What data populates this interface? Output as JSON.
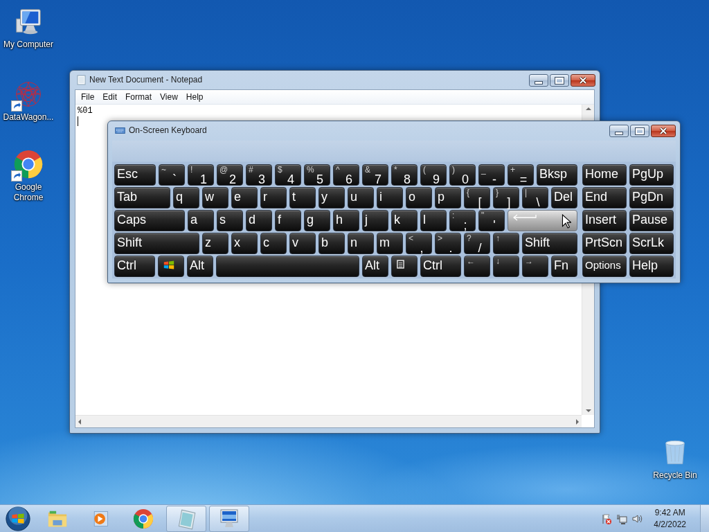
{
  "desktop_icons": [
    {
      "kind": "computer",
      "label": "My Computer",
      "shortcut": false
    },
    {
      "kind": "mesh",
      "label": "DataWagon...",
      "shortcut": true
    },
    {
      "kind": "chrome",
      "label": "Google Chrome",
      "shortcut": true
    },
    {
      "kind": "recycle",
      "label": "Recycle Bin",
      "shortcut": false
    }
  ],
  "notepad": {
    "title": "New Text Document - Notepad",
    "menu": [
      "File",
      "Edit",
      "Format",
      "View",
      "Help"
    ],
    "text": "%01"
  },
  "keyboard": {
    "title": "On-Screen Keyboard",
    "main_rows": [
      [
        {
          "kind": "char",
          "label": "Esc",
          "highlighted": false
        },
        {
          "kind": "char",
          "shift": "~",
          "label": "`",
          "highlighted": false
        },
        {
          "kind": "char",
          "shift": "!",
          "label": "1",
          "highlighted": false
        },
        {
          "kind": "char",
          "shift": "@",
          "label": "2",
          "highlighted": false
        },
        {
          "kind": "char",
          "shift": "#",
          "label": "3",
          "highlighted": false
        },
        {
          "kind": "char",
          "shift": "$",
          "label": "4",
          "highlighted": false
        },
        {
          "kind": "char",
          "shift": "%",
          "label": "5",
          "highlighted": false
        },
        {
          "kind": "char",
          "shift": "^",
          "label": "6",
          "highlighted": false
        },
        {
          "kind": "char",
          "shift": "&",
          "label": "7",
          "highlighted": false
        },
        {
          "kind": "char",
          "shift": "*",
          "label": "8",
          "highlighted": false
        },
        {
          "kind": "char",
          "shift": "(",
          "label": "9",
          "highlighted": false
        },
        {
          "kind": "char",
          "shift": ")",
          "label": "0",
          "highlighted": false
        },
        {
          "kind": "char",
          "shift": "_",
          "label": "-",
          "highlighted": false
        },
        {
          "kind": "char",
          "shift": "+",
          "label": "=",
          "highlighted": false
        },
        {
          "kind": "char",
          "label": "Bksp",
          "highlighted": false
        }
      ],
      [
        {
          "kind": "char",
          "label": "Tab",
          "highlighted": false
        },
        {
          "kind": "char",
          "label": "q",
          "highlighted": false
        },
        {
          "kind": "char",
          "label": "w",
          "highlighted": false
        },
        {
          "kind": "char",
          "label": "e",
          "highlighted": false
        },
        {
          "kind": "char",
          "label": "r",
          "highlighted": false
        },
        {
          "kind": "char",
          "label": "t",
          "highlighted": false
        },
        {
          "kind": "char",
          "label": "y",
          "highlighted": false
        },
        {
          "kind": "char",
          "label": "u",
          "highlighted": false
        },
        {
          "kind": "char",
          "label": "i",
          "highlighted": false
        },
        {
          "kind": "char",
          "label": "o",
          "highlighted": false
        },
        {
          "kind": "char",
          "label": "p",
          "highlighted": false
        },
        {
          "kind": "char",
          "shift": "{",
          "label": "[",
          "highlighted": false
        },
        {
          "kind": "char",
          "shift": "}",
          "label": "]",
          "highlighted": false
        },
        {
          "kind": "char",
          "shift": "|",
          "label": "\\",
          "highlighted": false
        },
        {
          "kind": "char",
          "label": "Del",
          "highlighted": false
        }
      ],
      [
        {
          "kind": "char",
          "label": "Caps",
          "highlighted": false
        },
        {
          "kind": "char",
          "label": "a",
          "highlighted": false
        },
        {
          "kind": "char",
          "label": "s",
          "highlighted": false
        },
        {
          "kind": "char",
          "label": "d",
          "highlighted": false
        },
        {
          "kind": "char",
          "label": "f",
          "highlighted": false
        },
        {
          "kind": "char",
          "label": "g",
          "highlighted": false
        },
        {
          "kind": "char",
          "label": "h",
          "highlighted": false
        },
        {
          "kind": "char",
          "label": "j",
          "highlighted": false
        },
        {
          "kind": "char",
          "label": "k",
          "highlighted": false
        },
        {
          "kind": "char",
          "label": "l",
          "highlighted": false
        },
        {
          "kind": "char",
          "shift": ":",
          "label": ";",
          "highlighted": false
        },
        {
          "kind": "char",
          "shift": "\"",
          "label": "'",
          "highlighted": false
        },
        {
          "kind": "enter",
          "highlighted": true
        }
      ],
      [
        {
          "kind": "char",
          "label": "Shift",
          "highlighted": false
        },
        {
          "kind": "char",
          "label": "z",
          "highlighted": false
        },
        {
          "kind": "char",
          "label": "x",
          "highlighted": false
        },
        {
          "kind": "char",
          "label": "c",
          "highlighted": false
        },
        {
          "kind": "char",
          "label": "v",
          "highlighted": false
        },
        {
          "kind": "char",
          "label": "b",
          "highlighted": false
        },
        {
          "kind": "char",
          "label": "n",
          "highlighted": false
        },
        {
          "kind": "char",
          "label": "m",
          "highlighted": false
        },
        {
          "kind": "char",
          "shift": "<",
          "label": ",",
          "highlighted": false
        },
        {
          "kind": "char",
          "shift": ">",
          "label": ".",
          "highlighted": false
        },
        {
          "kind": "char",
          "shift": "?",
          "label": "/",
          "highlighted": false
        },
        {
          "kind": "char",
          "shift": "↑",
          "highlighted": false
        },
        {
          "kind": "char",
          "label": "Shift",
          "highlighted": false
        }
      ],
      [
        {
          "kind": "char",
          "label": "Ctrl",
          "highlighted": false
        },
        {
          "kind": "windows",
          "highlighted": false
        },
        {
          "kind": "char",
          "label": "Alt",
          "highlighted": false
        },
        {
          "kind": "space",
          "highlighted": false
        },
        {
          "kind": "char",
          "label": "Alt",
          "highlighted": false
        },
        {
          "kind": "menu",
          "highlighted": false
        },
        {
          "kind": "char",
          "label": "Ctrl",
          "highlighted": false
        },
        {
          "kind": "char",
          "shift": "←",
          "highlighted": false
        },
        {
          "kind": "char",
          "shift": "↓",
          "highlighted": false
        },
        {
          "kind": "char",
          "shift": "→",
          "highlighted": false
        },
        {
          "kind": "char",
          "label": "Fn",
          "highlighted": false
        }
      ]
    ],
    "nav_rows": [
      [
        {
          "kind": "char",
          "label": "Home",
          "highlighted": false
        },
        {
          "kind": "char",
          "label": "PgUp",
          "highlighted": false
        }
      ],
      [
        {
          "kind": "char",
          "label": "End",
          "highlighted": false
        },
        {
          "kind": "char",
          "label": "PgDn",
          "highlighted": false
        }
      ],
      [
        {
          "kind": "char",
          "label": "Insert",
          "highlighted": false
        },
        {
          "kind": "char",
          "label": "Pause",
          "highlighted": false
        }
      ],
      [
        {
          "kind": "char",
          "label": "PrtScn",
          "highlighted": false
        },
        {
          "kind": "char",
          "label": "ScrLk",
          "highlighted": false
        }
      ],
      [
        {
          "kind": "char",
          "label": "Options",
          "highlighted": false
        },
        {
          "kind": "char",
          "label": "Help",
          "highlighted": false
        }
      ]
    ]
  },
  "taskbar": {
    "buttons": [
      {
        "kind": "explorer",
        "open": false
      },
      {
        "kind": "media",
        "open": false
      },
      {
        "kind": "chrome",
        "open": false
      },
      {
        "kind": "notepad",
        "open": true
      },
      {
        "kind": "keyboard",
        "open": true
      }
    ],
    "clock": {
      "time": "9:42 AM",
      "date": "4/2/2022"
    }
  }
}
